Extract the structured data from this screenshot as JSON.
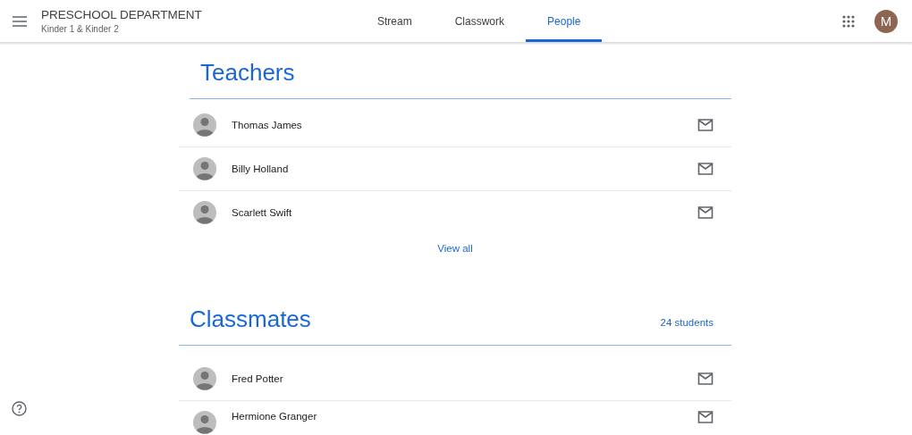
{
  "header": {
    "title": "PRESCHOOL DEPARTMENT",
    "subtitle": "Kinder 1 & Kinder 2",
    "avatar": "M"
  },
  "tabs": [
    {
      "label": "Stream",
      "selected": false
    },
    {
      "label": "Classwork",
      "selected": false
    },
    {
      "label": "People",
      "selected": true
    }
  ],
  "teachers": {
    "title": "Teachers",
    "people": [
      {
        "name": "Thomas James"
      },
      {
        "name": "Billy Holland"
      },
      {
        "name": "Scarlett Swift"
      }
    ],
    "view_all": "View all"
  },
  "classmates": {
    "title": "Classmates",
    "count": "24 students",
    "people": [
      {
        "name": "Fred Potter"
      },
      {
        "name": "Hermione Granger"
      }
    ]
  }
}
